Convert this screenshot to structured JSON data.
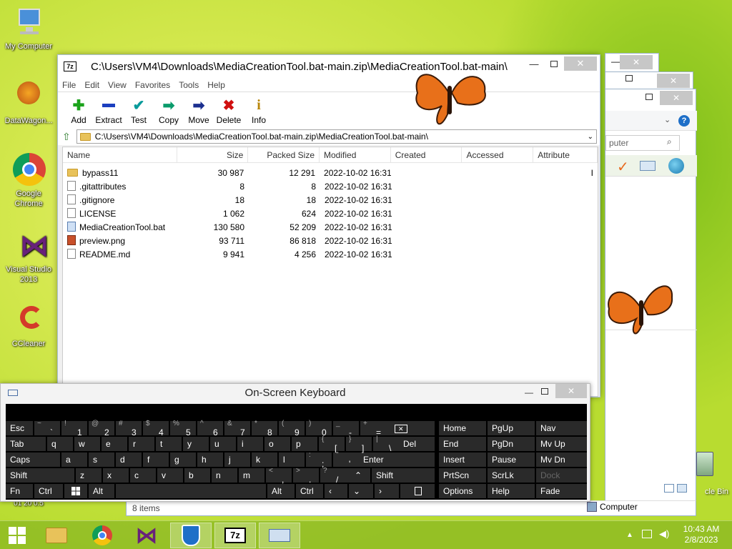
{
  "desktop": {
    "icons": [
      {
        "label": "My Computer",
        "icon": "computer-icon"
      },
      {
        "label": "DataWagon...",
        "icon": "datawagon-icon"
      },
      {
        "label": "Google Chrome",
        "icon": "chrome-icon"
      },
      {
        "label": "Visual Studio 2013",
        "icon": "visual-studio-icon"
      },
      {
        "label": "CCleaner",
        "icon": "ccleaner-icon"
      }
    ],
    "right_bin_label": "cle Bin",
    "left_partial_label": "01 20 0.5"
  },
  "zip": {
    "title": "C:\\Users\\VM4\\Downloads\\MediaCreationTool.bat-main.zip\\MediaCreationTool.bat-main\\",
    "menu": [
      "File",
      "Edit",
      "View",
      "Favorites",
      "Tools",
      "Help"
    ],
    "toolbar": [
      "Add",
      "Extract",
      "Test",
      "Copy",
      "Move",
      "Delete",
      "Info"
    ],
    "address": "C:\\Users\\VM4\\Downloads\\MediaCreationTool.bat-main.zip\\MediaCreationTool.bat-main\\",
    "columns": [
      "Name",
      "Size",
      "Packed Size",
      "Modified",
      "Created",
      "Accessed",
      "Attribute"
    ],
    "rows": [
      {
        "name": "bypass11",
        "size": "30 987",
        "packed": "12 291",
        "modified": "2022-10-02 16:31",
        "attr": "I"
      },
      {
        "name": ".gitattributes",
        "size": "8",
        "packed": "8",
        "modified": "2022-10-02 16:31",
        "attr": ""
      },
      {
        "name": ".gitignore",
        "size": "18",
        "packed": "18",
        "modified": "2022-10-02 16:31",
        "attr": ""
      },
      {
        "name": "LICENSE",
        "size": "1 062",
        "packed": "624",
        "modified": "2022-10-02 16:31",
        "attr": ""
      },
      {
        "name": "MediaCreationTool.bat",
        "size": "130 580",
        "packed": "52 209",
        "modified": "2022-10-02 16:31",
        "attr": ""
      },
      {
        "name": "preview.png",
        "size": "93 711",
        "packed": "86 818",
        "modified": "2022-10-02 16:31",
        "attr": ""
      },
      {
        "name": "README.md",
        "size": "9 941",
        "packed": "4 256",
        "modified": "2022-10-02 16:31",
        "attr": ""
      }
    ]
  },
  "explorer": {
    "search_placeholder": "puter",
    "status_items": "8 items",
    "status_computer": "Computer"
  },
  "osk": {
    "title": "On-Screen Keyboard",
    "keys": {
      "esc": "Esc",
      "tab": "Tab",
      "caps": "Caps",
      "shift": "Shift",
      "fn": "Fn",
      "ctrl": "Ctrl",
      "alt": "Alt",
      "del": "Del",
      "enter": "Enter",
      "rshift": "Shift",
      "ralt": "Alt",
      "rctrl": "Ctrl",
      "home": "Home",
      "pgup": "PgUp",
      "nav": "Nav",
      "end": "End",
      "pgdn": "PgDn",
      "mvup": "Mv Up",
      "insert": "Insert",
      "pause": "Pause",
      "mvdn": "Mv Dn",
      "prtscn": "PrtScn",
      "scrlk": "ScrLk",
      "dock": "Dock",
      "options": "Options",
      "help": "Help",
      "fade": "Fade",
      "row1": [
        [
          "~",
          "`"
        ],
        [
          "!",
          "1"
        ],
        [
          "@",
          "2"
        ],
        [
          "#",
          "3"
        ],
        [
          "$",
          "4"
        ],
        [
          "%",
          "5"
        ],
        [
          "^",
          "6"
        ],
        [
          "&",
          "7"
        ],
        [
          "*",
          "8"
        ],
        [
          "(",
          "9"
        ],
        [
          ")",
          "0"
        ],
        [
          "_",
          "-"
        ],
        [
          "+",
          "="
        ]
      ],
      "row2": [
        "q",
        "w",
        "e",
        "r",
        "t",
        "y",
        "u",
        "i",
        "o",
        "p",
        [
          "{",
          "["
        ],
        [
          "}",
          "]"
        ],
        [
          "|",
          "\\"
        ]
      ],
      "row3": [
        "a",
        "s",
        "d",
        "f",
        "g",
        "h",
        "j",
        "k",
        "l",
        [
          ":",
          ";"
        ],
        [
          "\"",
          "'"
        ]
      ],
      "row4": [
        "z",
        "x",
        "c",
        "v",
        "b",
        "n",
        "m",
        [
          "<",
          ","
        ],
        [
          ">",
          "."
        ],
        [
          "?",
          "/"
        ]
      ]
    }
  },
  "taskbar": {
    "time": "10:43 AM",
    "date": "2/8/2023"
  }
}
